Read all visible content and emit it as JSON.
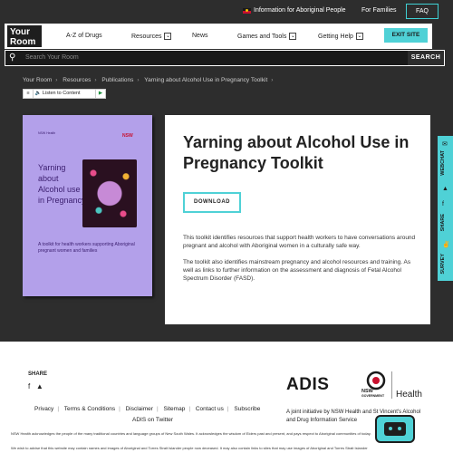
{
  "header": {
    "aboriginal_link": "Information for Aboriginal People",
    "families_link": "For Families",
    "faq": "FAQ",
    "logo_line1": "Your",
    "logo_line2": "Room",
    "nav": [
      {
        "label": "A-Z of Drugs"
      },
      {
        "label": "Resources",
        "has_dropdown": true
      },
      {
        "label": "News"
      },
      {
        "label": "Games and Tools",
        "has_dropdown": true
      },
      {
        "label": "Getting Help",
        "has_dropdown": true
      }
    ],
    "exit_site": "EXIT SITE",
    "search_placeholder": "Search Your Room",
    "search_button": "SEARCH"
  },
  "breadcrumb": [
    "Your Room",
    "Resources",
    "Publications",
    "Yarning about Alcohol Use in Pregnancy Toolkit"
  ],
  "listen": "Listen to Content",
  "cover": {
    "caption": "NSW Health",
    "nsw": "NSW",
    "title": "Yarning about Alcohol use in Pregnancy",
    "subtitle": "A toolkit for health workers supporting Aboriginal pregnant women and families"
  },
  "main": {
    "title": "Yarning about Alcohol Use in Pregnancy Toolkit",
    "download": "DOWNLOAD",
    "para1": "This toolkit identifies resources that support health workers to have conversations around pregnant and alcohol with Aboriginal women in a culturally safe way.",
    "para2": "The toolkit also identifies mainstream pregnancy and alcohol resources and training. As well as links to further information on the assessment and diagnosis of Fetal Alcohol Spectrum Disorder (FASD)."
  },
  "sidebar": {
    "webchat": "WEBCHAT",
    "share": "SHARE",
    "survey": "SURVEY"
  },
  "footer": {
    "share": "SHARE",
    "links": [
      "Privacy",
      "Terms & Conditions",
      "Disclaimer",
      "Sitemap",
      "Contact us",
      "Subscribe"
    ],
    "adis_twitter": "ADIS on Twitter",
    "adis_logo": "ADIS",
    "nsw_label": "NSW",
    "gov_label": "GOVERNMENT",
    "health": "Health",
    "joint": "A joint initiative by NSW Health and St Vincent's Alcohol and Drug Information Service",
    "ack1": "NSW Health acknowledges the people of the many traditional countries and language groups of New South Wales. It acknowledges the wisdom of Elders past and present, and pays respect to Aboriginal communities of today.",
    "ack2": "We wish to advise that this website may contain names and images of Aboriginal and Torres Strait Islander people now deceased. It may also contain links to sites that may use images of Aboriginal and Torres Strait Islander"
  },
  "colors": {
    "accent": "#4fd1d6",
    "dark": "#2d2d2d",
    "cover": "#b3a0ea"
  }
}
